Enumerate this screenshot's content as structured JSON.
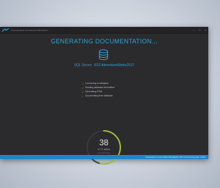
{
  "window": {
    "title": "Documentation for AdventureWorks2017"
  },
  "main": {
    "heading": "GENERATING DOCUMENTATION...",
    "database_label": "SQL Server",
    "database_name": "R12 AdventureWorks2017"
  },
  "steps": [
    {
      "label": "Connecting to database",
      "state": "done"
    },
    {
      "label": "Reading database information",
      "state": "done"
    },
    {
      "label": "Generating HTML",
      "state": "done"
    },
    {
      "label": "Documenting from database",
      "state": "pending"
    }
  ],
  "progress": {
    "current": "38",
    "of_text": "of 71 tables",
    "sub_text": "documenting",
    "current_value": 38,
    "total_value": 71
  },
  "status": {
    "text": "Connected to server Rally Ultimateplan with and Foreving: plan 1 2013"
  },
  "colors": {
    "accent": "#2aa6df",
    "progress": "#9cc33b",
    "statusbar": "#1e86c8"
  }
}
